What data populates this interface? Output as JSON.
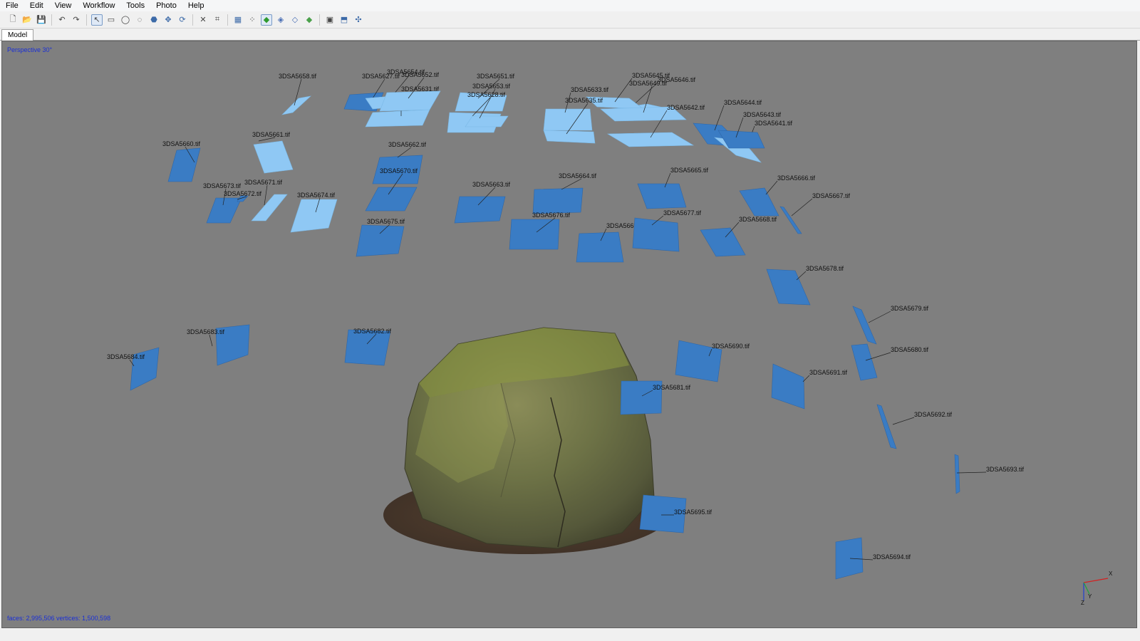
{
  "menu": [
    "File",
    "Edit",
    "View",
    "Workflow",
    "Tools",
    "Photo",
    "Help"
  ],
  "toolbar": {
    "buttons": [
      {
        "icon": "new-document-icon"
      },
      {
        "icon": "open-folder-icon"
      },
      {
        "icon": "save-icon"
      },
      {
        "sep": true
      },
      {
        "icon": "undo-icon"
      },
      {
        "icon": "redo-icon"
      },
      {
        "sep": true
      },
      {
        "icon": "navigation-cursor-icon",
        "active": true
      },
      {
        "icon": "rectangle-selection-icon"
      },
      {
        "icon": "circle-selection-icon"
      },
      {
        "icon": "free-form-selection-icon"
      },
      {
        "icon": "resize-region-icon"
      },
      {
        "icon": "move-region-icon"
      },
      {
        "icon": "rotate-region-icon"
      },
      {
        "sep": true
      },
      {
        "icon": "delete-selection-icon"
      },
      {
        "icon": "crop-selection-icon"
      },
      {
        "sep": true
      },
      {
        "icon": "show-cameras-icon"
      },
      {
        "icon": "point-cloud-icon"
      },
      {
        "icon": "shaded-model-icon",
        "active": true
      },
      {
        "icon": "solid-model-icon"
      },
      {
        "icon": "wireframe-model-icon"
      },
      {
        "icon": "textured-model-icon"
      },
      {
        "sep": true
      },
      {
        "icon": "show-photos-icon"
      },
      {
        "icon": "show-region-icon"
      },
      {
        "icon": "reset-view-icon"
      }
    ]
  },
  "tabs": [
    "Model"
  ],
  "viewport": {
    "view_mode": "Perspective 30°",
    "stats": "faces: 2,995,506 vertices: 1,500,598",
    "axis_labels": [
      "X",
      "Y",
      "Z"
    ],
    "colors": {
      "background": "#7f7f7f",
      "camera_dark": "#3a7cc4",
      "camera_light": "#8fc8f4",
      "label": "#111111",
      "overlay_text": "#1a2fd6",
      "axis_x": "#d42020",
      "axis_y": "#20a040",
      "axis_z": "#2040d0"
    },
    "cameras": [
      {
        "label": "3DSA5658.tif"
      },
      {
        "label": "3DSA5661.tif"
      },
      {
        "label": "3DSA5660.tif"
      },
      {
        "label": "3DSA5662.tif"
      },
      {
        "label": "3DSA5670.tif"
      },
      {
        "label": "3DSA5671.tif"
      },
      {
        "label": "3DSA5673.tif"
      },
      {
        "label": "3DSA5672.tif"
      },
      {
        "label": "3DSA5674.tif"
      },
      {
        "label": "3DSA5675.tif"
      },
      {
        "label": "3DSA5663.tif"
      },
      {
        "label": "3DSA5664.tif"
      },
      {
        "label": "3DSA5676.tif"
      },
      {
        "label": "3DSA5665.tif"
      },
      {
        "label": "3DSA5669.tif"
      },
      {
        "label": "3DSA5677.tif"
      },
      {
        "label": "3DSA5666.tif"
      },
      {
        "label": "3DSA5668.tif"
      },
      {
        "label": "3DSA5667.tif"
      },
      {
        "label": "3DSA5678.tif"
      },
      {
        "label": "3DSA5679.tif"
      },
      {
        "label": "3DSA5680.tif"
      },
      {
        "label": "3DSA5683.tif"
      },
      {
        "label": "3DSA5682.tif"
      },
      {
        "label": "3DSA5684.tif"
      },
      {
        "label": "3DSA5690.tif"
      },
      {
        "label": "3DSA5681.tif"
      },
      {
        "label": "3DSA5691.tif"
      },
      {
        "label": "3DSA5692.tif"
      },
      {
        "label": "3DSA5693.tif"
      },
      {
        "label": "3DSA5695.tif"
      },
      {
        "label": "3DSA5694.tif"
      },
      {
        "label": "3DSA5651.tif"
      },
      {
        "label": "3DSA5628.tif"
      },
      {
        "label": "3DSA5633.tif"
      },
      {
        "label": "3DSA5646.tif"
      },
      {
        "label": "3DSA5645.tif"
      },
      {
        "label": "3DSA5649.tif"
      },
      {
        "label": "3DSA5644.tif"
      },
      {
        "label": "3DSA5641.tif"
      },
      {
        "label": "3DSA5627.tif"
      },
      {
        "label": "3DSA5654.tif"
      },
      {
        "label": "3DSA5631.tif"
      },
      {
        "label": "3DSA5635.tif"
      },
      {
        "label": "3DSA5642.tif"
      },
      {
        "label": "3DSA5652.tif"
      },
      {
        "label": "3DSA5653.tif"
      },
      {
        "label": "3DSA5643.tif"
      }
    ]
  }
}
